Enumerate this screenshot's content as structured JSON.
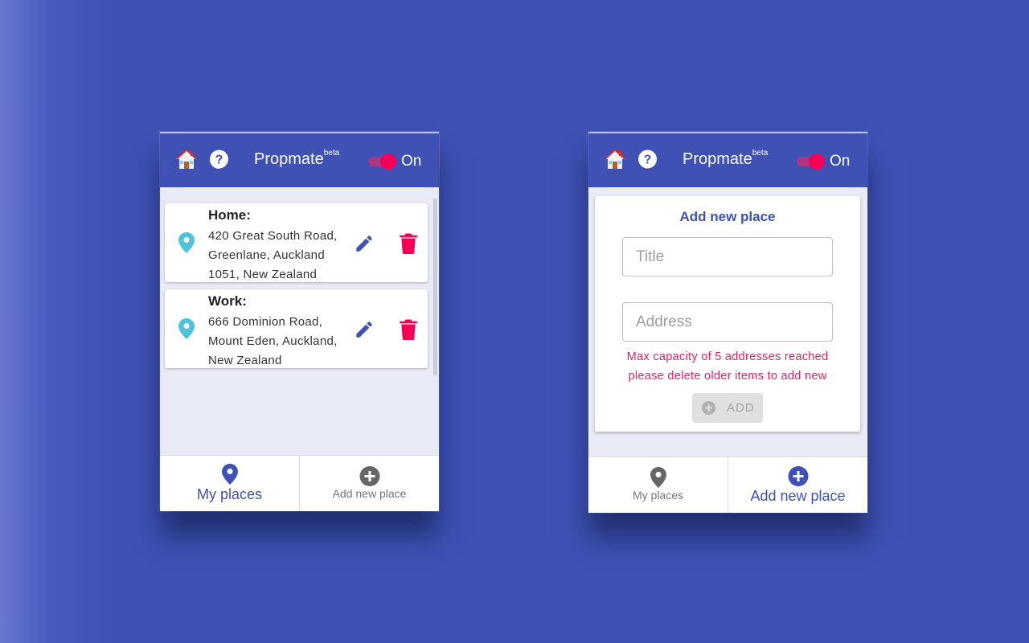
{
  "colors": {
    "primary": "#3f51b5",
    "accent": "#f50057",
    "pin": "#4fc3d9",
    "error": "#e91e63"
  },
  "header": {
    "brand": "Propmate",
    "brand_sup": "beta",
    "toggle_label": "On",
    "home_icon": "home-icon",
    "help_icon": "help-icon"
  },
  "places": [
    {
      "name": "Home:",
      "address_lines": [
        "420 Great South Road,",
        "Greenlane, Auckland",
        "1051, New Zealand"
      ]
    },
    {
      "name": "Work:",
      "address_lines": [
        "666 Dominion Road,",
        "Mount Eden, Auckland,",
        "New Zealand"
      ]
    }
  ],
  "nav": {
    "my_places": "My places",
    "add_new_place": "Add new place"
  },
  "form": {
    "title": "Add new place",
    "title_placeholder": "Title",
    "address_placeholder": "Address",
    "error_line1": "Max capacity of 5 addresses reached",
    "error_line2": "please delete older items to add new",
    "add_label": "ADD"
  }
}
